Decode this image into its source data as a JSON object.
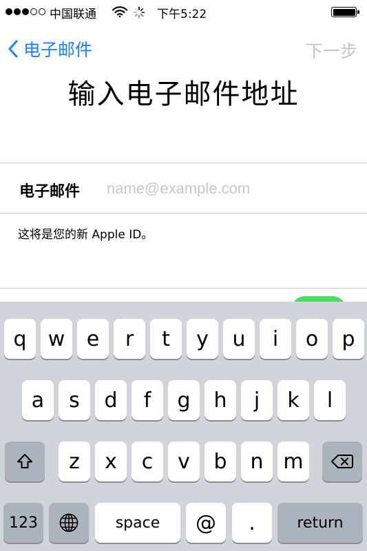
{
  "status": {
    "carrier": "中国联通",
    "time": "下午5:22",
    "signal_bars_filled": 3,
    "signal_bars_total": 5
  },
  "nav": {
    "back_label": "电子邮件",
    "next_label": "下一步"
  },
  "title": "输入电子邮件地址",
  "form": {
    "email_label": "电子邮件",
    "email_placeholder": "name@example.com",
    "email_value": "",
    "hint": "这将是您的新 Apple ID。",
    "toggle_on": true
  },
  "keyboard": {
    "row1": [
      "q",
      "w",
      "e",
      "r",
      "t",
      "y",
      "u",
      "i",
      "o",
      "p"
    ],
    "row2": [
      "a",
      "s",
      "d",
      "f",
      "g",
      "h",
      "j",
      "k",
      "l"
    ],
    "row3": [
      "z",
      "x",
      "c",
      "v",
      "b",
      "n",
      "m"
    ],
    "numbers_label": "123",
    "space_label": "space",
    "at_label": "@",
    "dot_label": ".",
    "return_label": "return"
  },
  "colors": {
    "accent": "#1a82fb",
    "disabled": "#c4c4c8",
    "toggle_on": "#4cd964",
    "keyboard_bg": "#d1d5db"
  }
}
